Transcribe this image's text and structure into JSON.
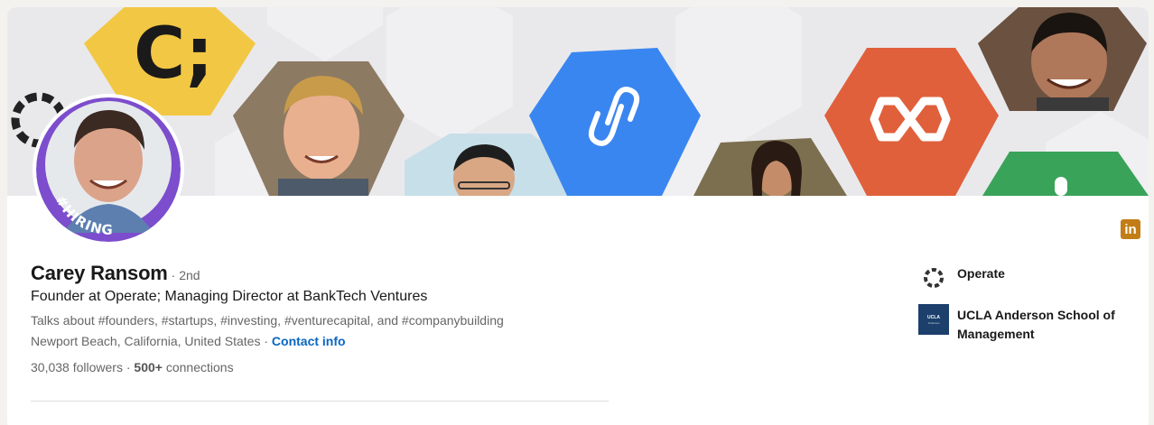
{
  "profile": {
    "name": "Carey Ransom",
    "degree": "· 2nd",
    "headline": "Founder at Operate; Managing Director at BankTech Ventures",
    "talks_about": "Talks about #founders, #startups, #investing, #venturecapital, and #companybuilding",
    "location": "Newport Beach, California, United States",
    "location_separator": " · ",
    "contact_info": "Contact info",
    "followers": "30,038",
    "followers_label": "followers",
    "connections_prefix": " · ",
    "connections": "500+",
    "connections_label": "connections",
    "avatar_badge": "#HIRING"
  },
  "banner": {
    "tiles": [
      "c-semicolon-logo",
      "person-photo",
      "person-photo",
      "chain-link-logo",
      "person-photo",
      "arrows-logo",
      "person-photo",
      "operate-logo"
    ]
  },
  "sidebar": {
    "items": [
      {
        "label": "Operate",
        "icon": "operate-logo"
      },
      {
        "label": "UCLA Anderson School of Management",
        "icon": "ucla-anderson-logo",
        "logo_text_1": "UCLA",
        "logo_text_2": "Anderson"
      }
    ]
  },
  "linkedin_badge": "in",
  "colors": {
    "link": "#0a66c2",
    "hiring_ring": "#7c4dcc",
    "linkedin_badge": "#c37d16",
    "hex_yellow": "#f2c744",
    "hex_blue": "#3a86f0",
    "hex_orange": "#e0603c",
    "hex_green": "#3aa35a"
  }
}
